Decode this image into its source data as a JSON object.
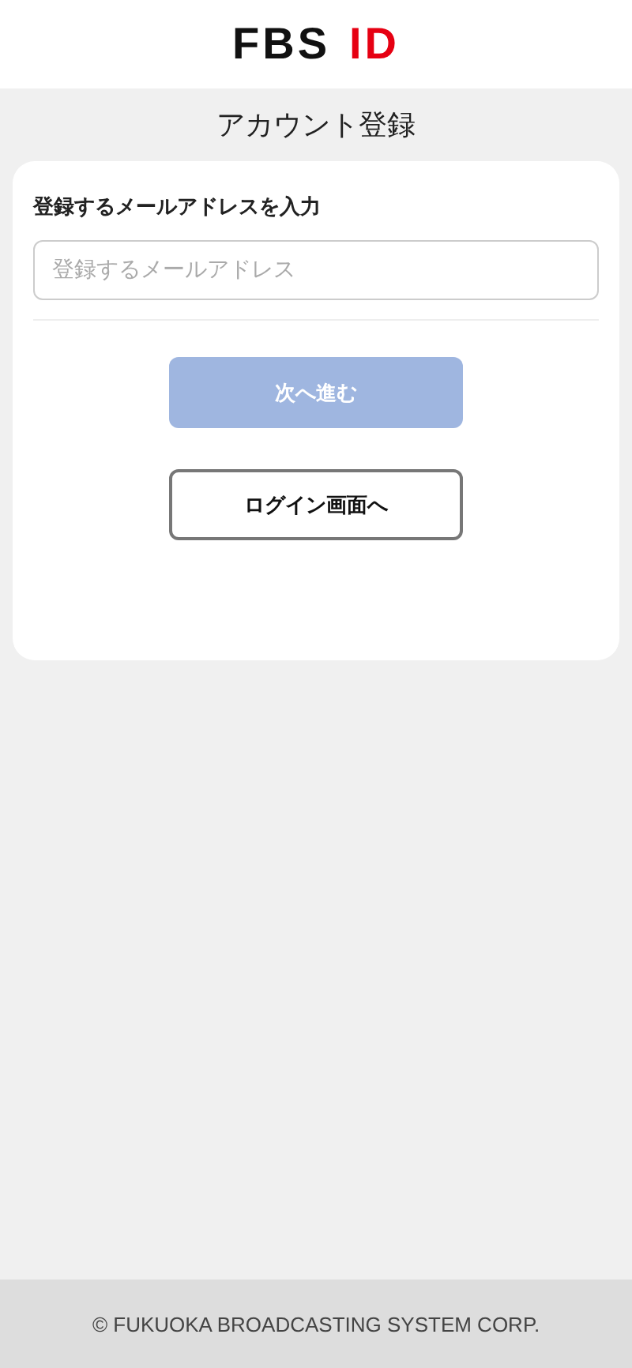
{
  "logo": {
    "primary": "FBS",
    "accent": "ID"
  },
  "title": "アカウント登録",
  "form": {
    "label": "登録するメールアドレスを入力",
    "email_field": {
      "placeholder": "登録するメールアドレス"
    }
  },
  "buttons": [
    {
      "kind": "primary",
      "label": "次へ進む",
      "disabled": true
    },
    {
      "kind": "outline",
      "label": "ログイン画面へ",
      "disabled": false
    }
  ],
  "footer": "© FUKUOKA BROADCASTING SYSTEM CORP."
}
